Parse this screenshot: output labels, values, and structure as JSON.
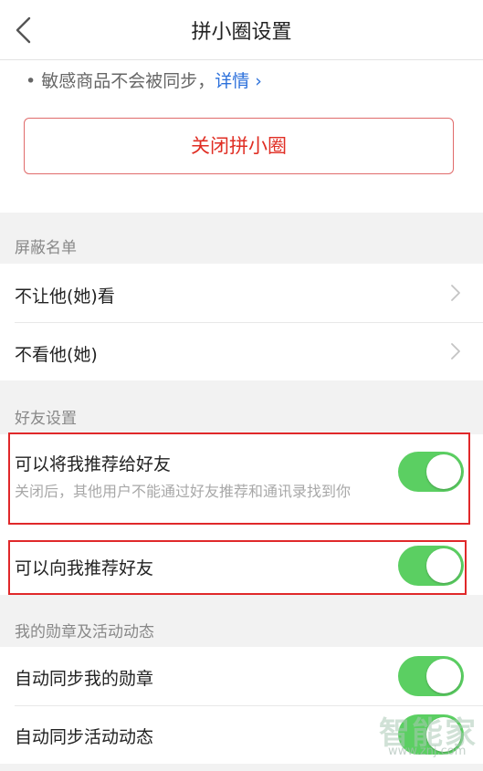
{
  "header": {
    "title": "拼小圈设置",
    "back_icon": "chevron-left-icon"
  },
  "top": {
    "note_prefix": "• 敏感商品不会被同步，",
    "note_link": "详情 ›",
    "close_button": "关闭拼小圈"
  },
  "block_list": {
    "title": "屏蔽名单",
    "items": [
      {
        "label": "不让他(她)看",
        "icon": "chevron-right-icon"
      },
      {
        "label": "不看他(她)",
        "icon": "chevron-right-icon"
      }
    ]
  },
  "friend_settings": {
    "title": "好友设置",
    "items": [
      {
        "label": "可以将我推荐给好友",
        "sub": "关闭后，其他用户不能通过好友推荐和通讯录找到你",
        "on": true
      },
      {
        "label": "可以向我推荐好友",
        "on": true
      }
    ]
  },
  "badges": {
    "title": "我的勋章及活动动态",
    "items": [
      {
        "label": "自动同步我的勋章",
        "on": true
      },
      {
        "label": "自动同步活动动态",
        "on": true
      }
    ]
  },
  "watermark": {
    "text": "智能家",
    "url": "www.znj.com"
  },
  "colors": {
    "accent_red": "#e02e24",
    "toggle_on": "#5bcf62",
    "link_blue": "#2a6fdb",
    "highlight": "#e0282a"
  }
}
